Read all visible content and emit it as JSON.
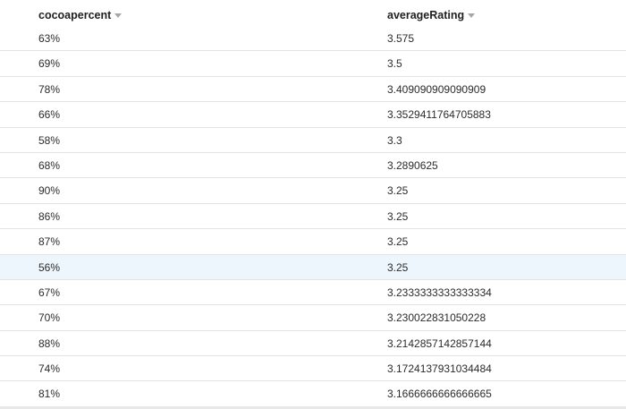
{
  "columns": [
    {
      "label": "cocoapercent"
    },
    {
      "label": "averageRating"
    }
  ],
  "rows": [
    [
      "63%",
      "3.575"
    ],
    [
      "69%",
      "3.5"
    ],
    [
      "78%",
      "3.409090909090909"
    ],
    [
      "66%",
      "3.3529411764705883"
    ],
    [
      "58%",
      "3.3"
    ],
    [
      "68%",
      "3.2890625"
    ],
    [
      "90%",
      "3.25"
    ],
    [
      "86%",
      "3.25"
    ],
    [
      "87%",
      "3.25"
    ],
    [
      "56%",
      "3.25"
    ],
    [
      "67%",
      "3.2333333333333334"
    ],
    [
      "70%",
      "3.230022831050228"
    ],
    [
      "88%",
      "3.2142857142857144"
    ],
    [
      "74%",
      "3.1724137931034484"
    ],
    [
      "81%",
      "3.1666666666666665"
    ]
  ],
  "highlighted_row_index": 9,
  "colors": {
    "highlight": "#eef6fd",
    "border": "#e3e3e3"
  },
  "icons": {
    "sort": "caret-down-icon"
  }
}
